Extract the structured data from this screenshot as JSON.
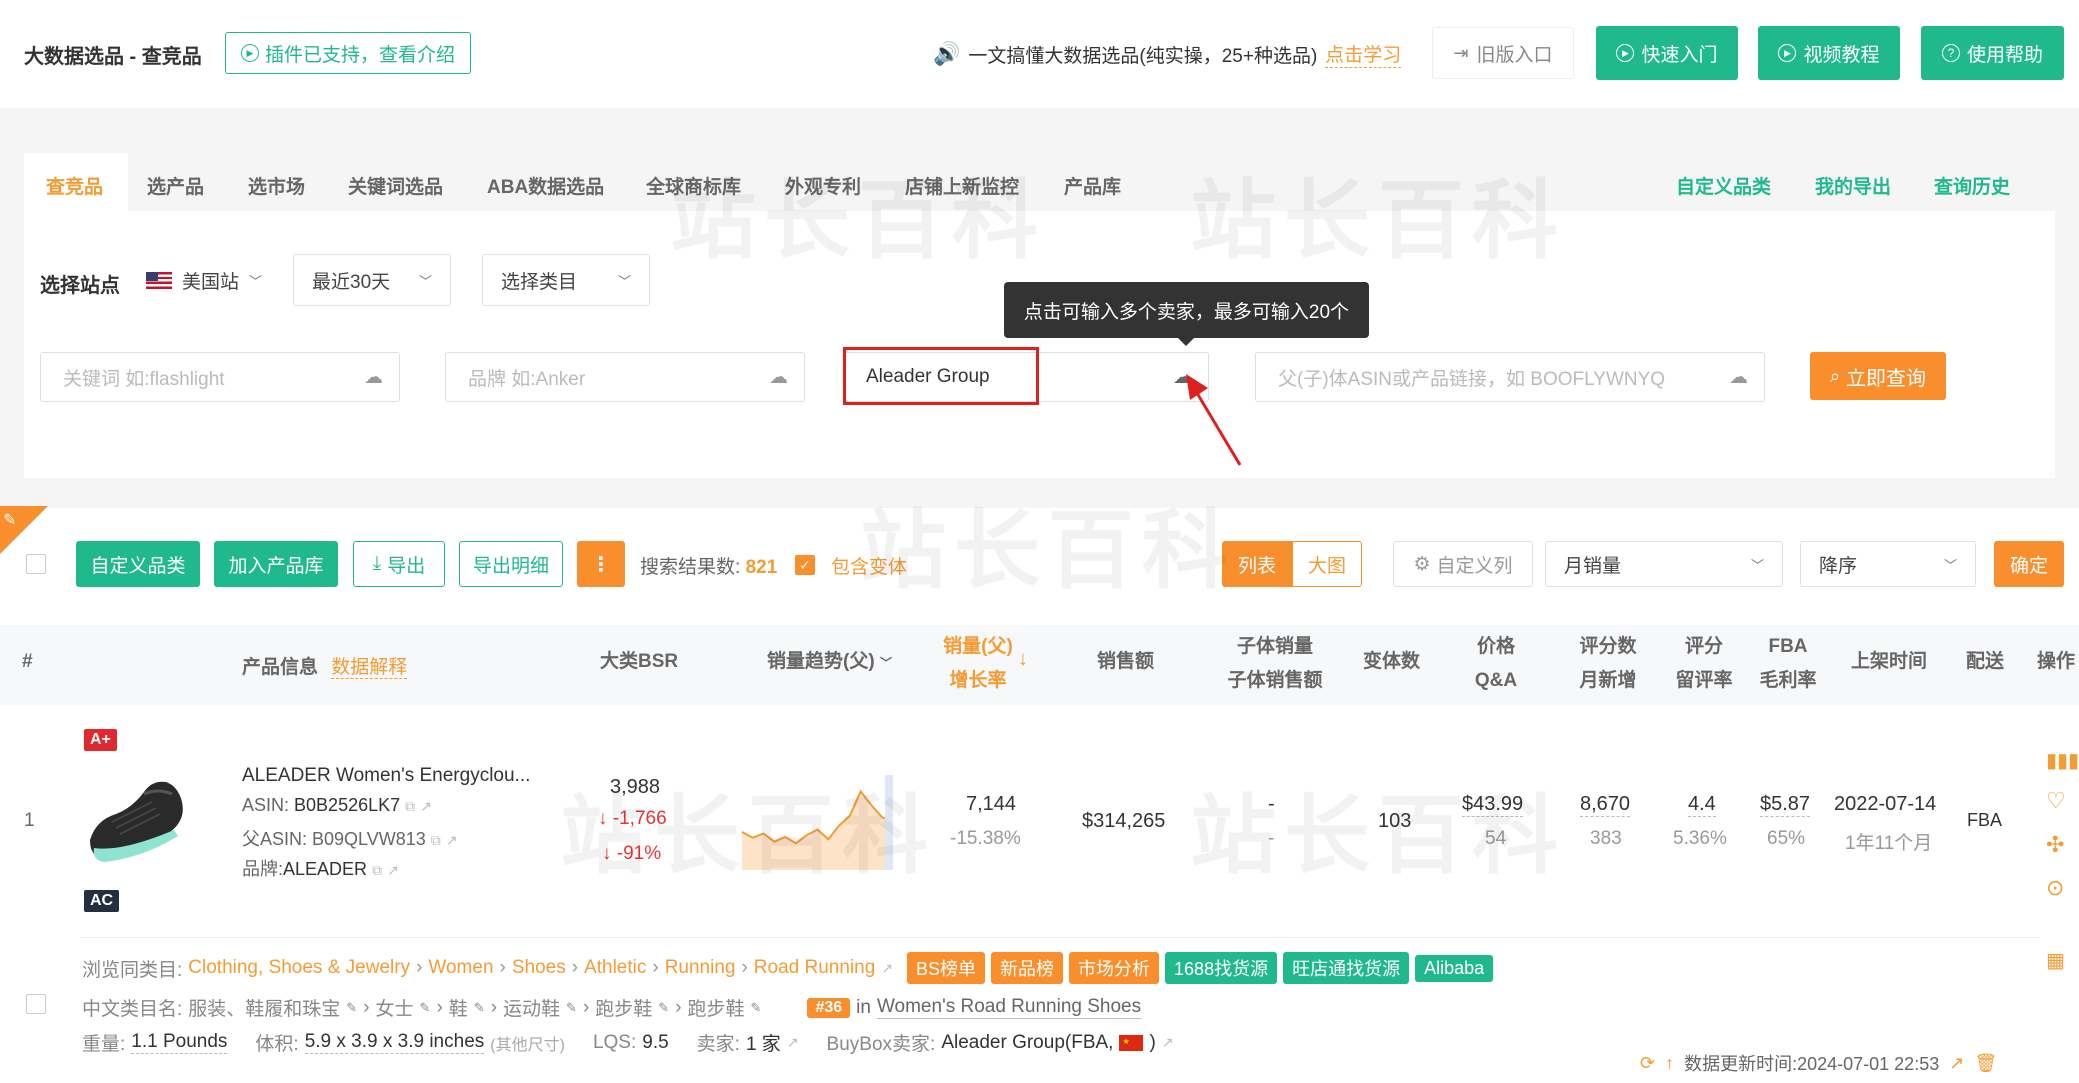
{
  "header": {
    "title": "大数据选品 - 查竞品",
    "plugin_btn": "插件已支持，查看介绍",
    "notice_text": "一文搞懂大数据选品(纯实操，25+种选品)",
    "notice_link": "点击学习",
    "old_version": "旧版入口",
    "quick_start": "快速入门",
    "video_tutorial": "视频教程",
    "help": "使用帮助"
  },
  "tabs": [
    "查竞品",
    "选产品",
    "选市场",
    "关键词选品",
    "ABA数据选品",
    "全球商标库",
    "外观专利",
    "店铺上新监控",
    "产品库"
  ],
  "right_links": [
    "自定义品类",
    "我的导出",
    "查询历史"
  ],
  "filters": {
    "site_label": "选择站点",
    "site": "美国站",
    "period": "最近30天",
    "category": "选择类目"
  },
  "search": {
    "keyword_placeholder": "关键词 如:flashlight",
    "brand_placeholder": "品牌 如:Anker",
    "seller_value": "Aleader Group",
    "asin_placeholder": "父(子)体ASIN或产品链接，如 BOOFLYWNYQ",
    "tooltip": "点击可输入多个卖家，最多可输入20个",
    "query_btn": "立即查询"
  },
  "toolbar": {
    "custom_category": "自定义品类",
    "add_library": "加入产品库",
    "export": "导出",
    "export_detail": "导出明细",
    "result_label": "搜索结果数:",
    "result_count": "821",
    "include_variants": "包含变体",
    "view_list": "列表",
    "view_big": "大图",
    "custom_cols": "自定义列",
    "sort_field": "月销量",
    "sort_order": "降序",
    "confirm": "确定"
  },
  "table_headers": {
    "index": "#",
    "product_info": "产品信息",
    "data_explain": "数据解释",
    "bsr": "大类BSR",
    "trend": "销量趋势(父)",
    "sales_top": "销量(父)",
    "sales_bottom": "增长率",
    "revenue": "销售额",
    "child_top": "子体销量",
    "child_bottom": "子体销售额",
    "variants": "变体数",
    "price_top": "价格",
    "price_bottom": "Q&A",
    "reviews_top": "评分数",
    "reviews_bottom": "月新增",
    "rating_top": "评分",
    "rating_bottom": "留评率",
    "fba_top": "FBA",
    "fba_bottom": "毛利率",
    "listed": "上架时间",
    "delivery": "配送",
    "action": "操作"
  },
  "product": {
    "index": "1",
    "badge_top": "A+",
    "badge_bottom": "AC",
    "title": "ALEADER Women's Energyclou...",
    "asin_label": "ASIN:",
    "asin": "B0B2526LK7",
    "parent_label": "父ASIN:",
    "parent_asin": "B09QLVW813",
    "brand_label": "品牌:",
    "brand": "ALEADER",
    "bsr": "3,988",
    "bsr_change": "-1,766",
    "bsr_pct": "-91%",
    "sales": "7,144",
    "growth": "-15.38%",
    "revenue": "$314,265",
    "child_sales": "-",
    "child_revenue": "-",
    "variants": "103",
    "price": "$43.99",
    "qa": "54",
    "reviews": "8,670",
    "reviews_new": "383",
    "rating": "4.4",
    "review_rate": "5.36%",
    "fba_fee": "$5.87",
    "margin": "65%",
    "listed": "2022-07-14",
    "listed_ago": "1年11个月",
    "delivery": "FBA"
  },
  "trend_chart": {
    "series": [
      0.42,
      0.35,
      0.4,
      0.3,
      0.36,
      0.28,
      0.38,
      0.45,
      0.33,
      0.5,
      0.62,
      0.92,
      0.75,
      0.6,
      0.55
    ]
  },
  "detail": {
    "browse_label": "浏览同类目:",
    "browse_path": [
      "Clothing, Shoes & Jewelry",
      "Women",
      "Shoes",
      "Athletic",
      "Running",
      "Road Running"
    ],
    "tags": [
      "BS榜单",
      "新品榜",
      "市场分析",
      "1688找货源",
      "旺店通找货源",
      "Alibaba"
    ],
    "cn_label": "中文类目名:",
    "cn_path": [
      "服装、鞋履和珠宝",
      "女士",
      "鞋",
      "运动鞋",
      "跑步鞋",
      "跑步鞋"
    ],
    "rank_badge": "#36",
    "rank_in": "in",
    "rank_cat": "Women's Road Running Shoes",
    "weight_label": "重量:",
    "weight": "1.1 Pounds",
    "volume_label": "体积:",
    "volume": "5.9 x 3.9 x 3.9 inches",
    "volume_note": "(其他尺寸)",
    "lqs_label": "LQS:",
    "lqs": "9.5",
    "sellers_label": "卖家:",
    "sellers": "1 家",
    "buybox_label": "BuyBox卖家:",
    "buybox": "Aleader Group(FBA,",
    "buybox_end": ")",
    "update_time": "数据更新时间:2024-07-01 22:53"
  },
  "watermark": "站长百科",
  "colors": {
    "green": "#20b98e",
    "orange": "#f49c34",
    "red": "#e93434"
  }
}
